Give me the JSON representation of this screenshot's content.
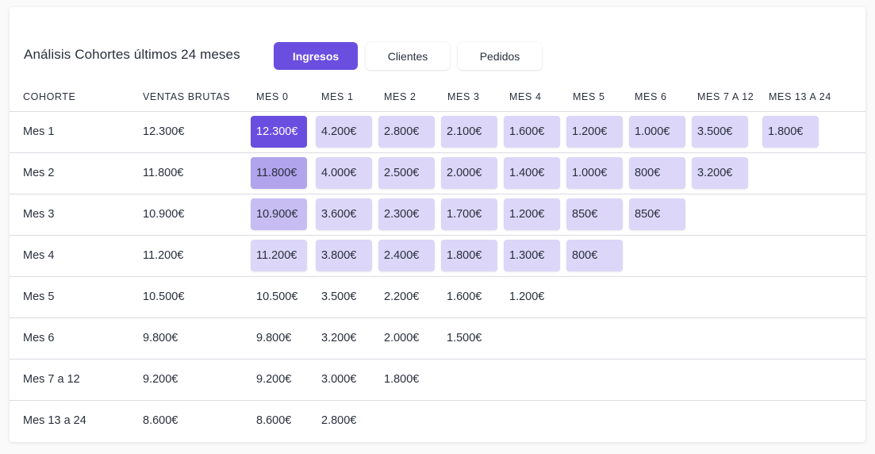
{
  "title": "Análisis Cohortes últimos 24 meses",
  "tabs": [
    {
      "label": "Ingresos",
      "active": true
    },
    {
      "label": "Clientes",
      "active": false
    },
    {
      "label": "Pedidos",
      "active": false
    }
  ],
  "columns": {
    "cohort": "COHORTE",
    "sales": "VENTAS BRUTAS",
    "months": [
      "MES 0",
      "MES 1",
      "MES 2",
      "MES 3",
      "MES 4",
      "MES 5",
      "MES 6",
      "MES 7 A 12",
      "MES 13 A 24"
    ]
  },
  "colors": {
    "accent": "#6a4ee0",
    "cell_light": "#dcd6f8",
    "cell_medium": "#b1a4ed",
    "cell_soft": "#c7bdf3"
  },
  "rows": [
    {
      "label": "Mes 1",
      "sales": "12.300€",
      "cells": [
        "12.300€",
        "4.200€",
        "2.800€",
        "2.100€",
        "1.600€",
        "1.200€",
        "1.000€",
        "3.500€",
        "1.800€"
      ],
      "highlighted": true
    },
    {
      "label": "Mes 2",
      "sales": "11.800€",
      "cells": [
        "11.800€",
        "4.000€",
        "2.500€",
        "2.000€",
        "1.400€",
        "1.000€",
        "800€",
        "3.200€"
      ],
      "highlighted": true
    },
    {
      "label": "Mes 3",
      "sales": "10.900€",
      "cells": [
        "10.900€",
        "3.600€",
        "2.300€",
        "1.700€",
        "1.200€",
        "850€",
        "850€"
      ],
      "highlighted": true
    },
    {
      "label": "Mes 4",
      "sales": "11.200€",
      "cells": [
        "11.200€",
        "3.800€",
        "2.400€",
        "1.800€",
        "1.300€",
        "800€"
      ],
      "highlighted": true
    },
    {
      "label": "Mes 5",
      "sales": "10.500€",
      "cells": [
        "10.500€",
        "3.500€",
        "2.200€",
        "1.600€",
        "1.200€"
      ],
      "highlighted": false
    },
    {
      "label": "Mes 6",
      "sales": "9.800€",
      "cells": [
        "9.800€",
        "3.200€",
        "2.000€",
        "1.500€"
      ],
      "highlighted": false
    },
    {
      "label": "Mes 7 a 12",
      "sales": "9.200€",
      "cells": [
        "9.200€",
        "3.000€",
        "1.800€"
      ],
      "highlighted": false
    },
    {
      "label": "Mes 13 a 24",
      "sales": "8.600€",
      "cells": [
        "8.600€",
        "2.800€"
      ],
      "highlighted": false
    }
  ]
}
